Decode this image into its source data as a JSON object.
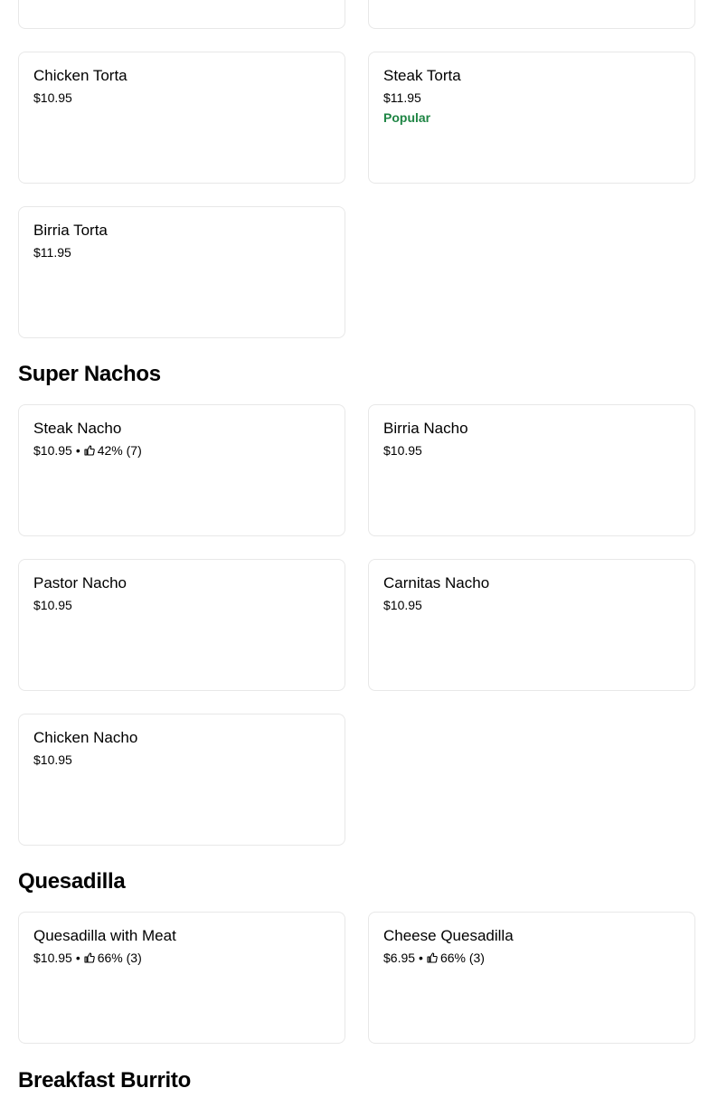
{
  "colors": {
    "popular": "#1e8544",
    "border": "#e8e8e8"
  },
  "top_partial_cards": [
    "",
    ""
  ],
  "tortas": [
    {
      "name": "Chicken Torta",
      "price": "$10.95"
    },
    {
      "name": "Steak Torta",
      "price": "$11.95",
      "badge": "Popular"
    },
    {
      "name": "Birria Torta",
      "price": "$11.95"
    }
  ],
  "sections": {
    "super_nachos": {
      "title": "Super Nachos",
      "items": [
        {
          "name": "Steak Nacho",
          "price": "$10.95",
          "separator": "•",
          "rating": "42% (7)",
          "icon": "thumbs-up-icon"
        },
        {
          "name": "Birria Nacho",
          "price": "$10.95"
        },
        {
          "name": "Pastor Nacho",
          "price": "$10.95"
        },
        {
          "name": "Carnitas Nacho",
          "price": "$10.95"
        },
        {
          "name": "Chicken Nacho",
          "price": "$10.95"
        }
      ]
    },
    "quesadilla": {
      "title": "Quesadilla",
      "items": [
        {
          "name": "Quesadilla with Meat",
          "price": "$10.95",
          "separator": "•",
          "rating": "66% (3)",
          "icon": "thumbs-up-icon"
        },
        {
          "name": "Cheese Quesadilla",
          "price": "$6.95",
          "separator": "•",
          "rating": "66% (3)",
          "icon": "thumbs-up-icon"
        }
      ]
    },
    "breakfast_burrito": {
      "title": "Breakfast Burrito"
    }
  }
}
